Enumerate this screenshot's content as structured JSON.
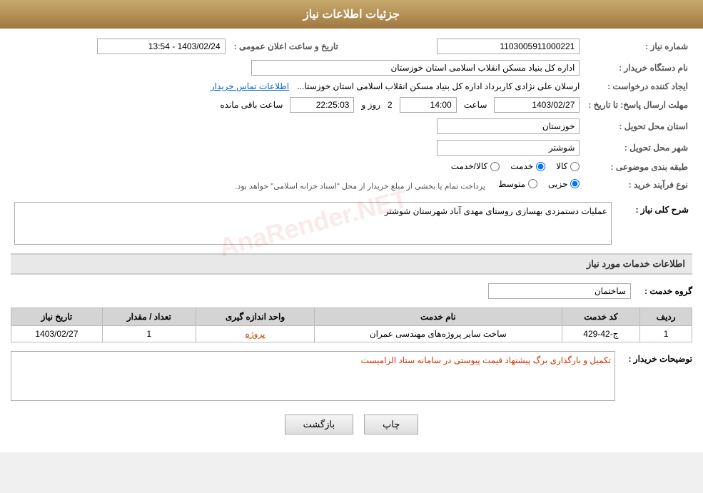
{
  "page": {
    "title": "جزئیات اطلاعات نیاز",
    "colors": {
      "header_bg_start": "#c8a96e",
      "header_bg_end": "#a07840",
      "accent": "#0066cc",
      "red_link": "#cc4400"
    }
  },
  "header": {
    "title": "جزئیات اطلاعات نیاز"
  },
  "fields": {
    "shomara_niaz_label": "شماره نیاز :",
    "shomara_niaz_value": "1103005911000221",
    "tarikh_label": "تاریخ و ساعت اعلان عمومی :",
    "tarikh_value": "1403/02/24 - 13:54",
    "nam_dastgah_label": "نام دستگاه خریدار :",
    "nam_dastgah_value": "اداره کل بنیاد مسکن انقلاب اسلامی استان خوزستان",
    "ijad_label": "ایجاد کننده درخواست :",
    "ijad_value": "ارسلان علی نژادی کاربرداد اداره کل بنیاد مسکن انقلاب اسلامی استان خوزستا...",
    "etelaaat_tamas_link": "اطلاعات تماس خریدار",
    "mohlat_label": "مهلت ارسال پاسخ: تا تاریخ :",
    "mohlat_date": "1403/02/27",
    "mohlat_saat_label": "ساعت",
    "mohlat_saat_value": "14:00",
    "mohlat_rooz_label": "روز و",
    "mohlat_rooz_value": "2",
    "mohlat_remaining_label": "ساعت باقی مانده",
    "mohlat_remaining_value": "22:25:03",
    "ostan_label": "استان محل تحویل :",
    "ostan_value": "خوزستان",
    "shahr_label": "شهر محل تحویل :",
    "shahr_value": "شوشتر",
    "tabaghebandi_label": "طبقه بندی موضوعی :",
    "radio_kala": "کالا",
    "radio_khedmat": "خدمت",
    "radio_kala_khedmat": "کالا/خدمت",
    "radio_kala_selected": false,
    "radio_khedmat_selected": true,
    "radio_kala_khedmat_selected": false,
    "nooe_farayand_label": "نوع فرآیند خرید :",
    "radio_jozi": "جزیی",
    "radio_mottavaset": "متوسط",
    "process_description": "پرداخت تمام یا بخشی از مبلغ خریدار از محل \"اسناد خزانه اسلامی\" خواهد بود.",
    "sharh_label": "شرح کلی نیاز :",
    "sharh_value": "عملیات دستمزدی بهسازی روستای  مهدی آباد  شهرستان شوشتر",
    "services_section_title": "اطلاعات خدمات مورد نیاز",
    "group_service_label": "گروه خدمت :",
    "group_service_value": "ساختمان",
    "table": {
      "headers": [
        "ردیف",
        "کد خدمت",
        "نام خدمت",
        "واحد اندازه گیری",
        "تعداد / مقدار",
        "تاریخ نیاز"
      ],
      "rows": [
        {
          "radif": "1",
          "kod_khedmat": "ج-42-429",
          "nam_khedmat": "ساخت سایر پروژه‌های مهندسی عمران",
          "vahed": "پروژه",
          "tedad": "1",
          "tarikh": "1403/02/27"
        }
      ],
      "vahed_link": "پروژه"
    },
    "buyer_desc_label": "توضیحات خریدار :",
    "buyer_desc_value": "تکمیل و بارگذاری برگ پیشنهاد قیمت پیوستی در سامانه ستاد الزامیست",
    "btn_print": "چاپ",
    "btn_back": "بازگشت"
  }
}
